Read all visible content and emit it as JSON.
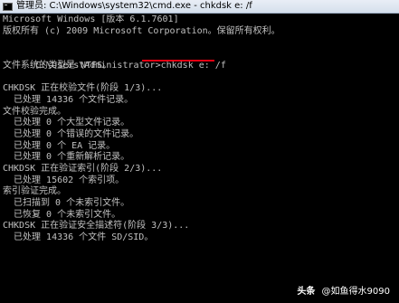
{
  "window": {
    "title": "管理员: C:\\Windows\\system32\\cmd.exe - chkdsk  e: /f",
    "icon": "cmd-icon"
  },
  "console": {
    "lines": [
      "Microsoft Windows [版本 6.1.7601]",
      "版权所有 (c) 2009 Microsoft Corporation。保留所有权利。",
      "",
      "C:\\Users\\Administrator>chkdsk e: /f",
      "文件系统的类型是 NTFS。",
      "",
      "CHKDSK 正在校验文件(阶段 1/3)...",
      "  已处理 14336 个文件记录。",
      "文件校验完成。",
      "  已处理 0 个大型文件记录。",
      "  已处理 0 个错误的文件记录。",
      "  已处理 0 个 EA 记录。",
      "  已处理 0 个重新解析记录。",
      "CHKDSK 正在验证索引(阶段 2/3)...",
      "  已处理 15602 个索引项。",
      "索引验证完成。",
      "  已扫描到 0 个未索引文件。",
      "  已恢复 0 个未索引文件。",
      "CHKDSK 正在验证安全描述符(阶段 3/3)...",
      "  已处理 14336 个文件 SD/SID。"
    ],
    "text_color": "#c0c0c0",
    "background": "#000000",
    "highlight_color": "#e60012"
  },
  "watermark": {
    "brand": "头条",
    "handle": "@如鱼得水9090"
  }
}
